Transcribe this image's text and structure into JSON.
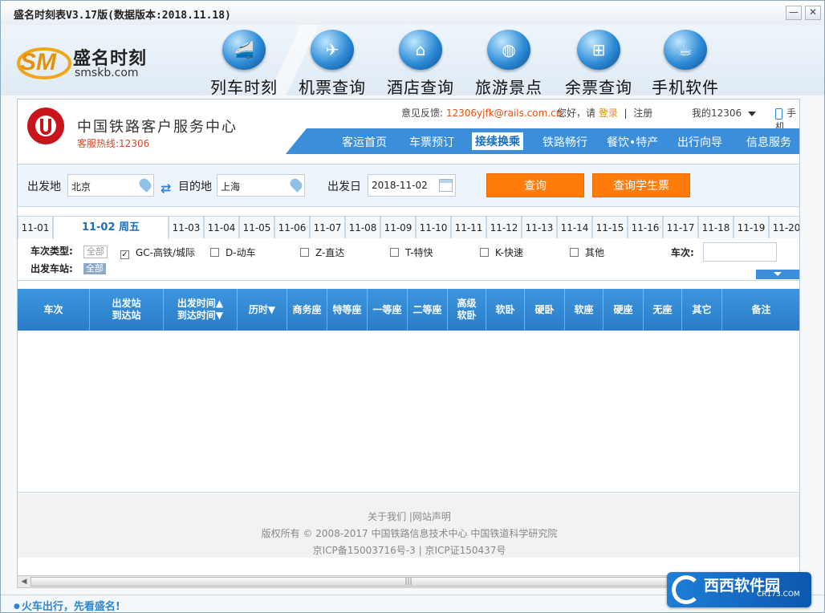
{
  "window": {
    "title": "盛名时刻表V3.17版(数据版本:2018.11.18)",
    "min": "—",
    "close": "✕"
  },
  "brand": {
    "name": "盛名时刻",
    "url": "smskb.com",
    "logo_text": "SM"
  },
  "nav": [
    {
      "label": "列车时刻",
      "icon": "train-icon"
    },
    {
      "label": "机票查询",
      "icon": "plane-icon"
    },
    {
      "label": "酒店查询",
      "icon": "hotel-icon"
    },
    {
      "label": "旅游景点",
      "icon": "globe-icon"
    },
    {
      "label": "余票查询",
      "icon": "windows-icon"
    },
    {
      "label": "手机软件",
      "icon": "java-icon"
    }
  ],
  "site": {
    "center_name": "中国铁路客户服务中心",
    "hotline": "客服热线:12306",
    "feedback_label": "意见反馈:",
    "feedback_email": "12306yjfk@rails.com.cn",
    "greeting": "您好，请",
    "login": "登录",
    "sep": "|",
    "register": "注册",
    "my12306": "我的12306",
    "phone": "手机",
    "menu": [
      "客运首页",
      "车票预订",
      "接续换乘",
      "铁路畅行",
      "餐饮•特产",
      "出行向导",
      "信息服务"
    ],
    "active_menu": "接续换乘"
  },
  "search": {
    "from_label": "出发地",
    "from_value": "北京",
    "to_label": "目的地",
    "to_value": "上海",
    "date_label": "出发日",
    "date_value": "2018-11-02",
    "query_btn": "查询",
    "student_btn": "查询学生票"
  },
  "dates": [
    "11-01",
    "11-02 周五",
    "11-03",
    "11-04",
    "11-05",
    "11-06",
    "11-07",
    "11-08",
    "11-09",
    "11-10",
    "11-11",
    "11-12",
    "11-13",
    "11-14",
    "11-15",
    "11-16",
    "11-17",
    "11-18",
    "11-19",
    "11-20"
  ],
  "filter": {
    "type_label": "车次类型:",
    "station_label": "出发车站:",
    "all": "全部",
    "types": [
      {
        "label": "GC-高铁/城际",
        "checked": true
      },
      {
        "label": "D-动车",
        "checked": false
      },
      {
        "label": "Z-直达",
        "checked": false
      },
      {
        "label": "T-特快",
        "checked": false
      },
      {
        "label": "K-快速",
        "checked": false
      },
      {
        "label": "其他",
        "checked": false
      }
    ],
    "train_no_label": "车次:",
    "checkmark": "✓"
  },
  "table_headers": [
    "车次",
    "出发站\n到达站",
    "出发时间▲\n到达时间▼",
    "历时▼",
    "商务座",
    "特等座",
    "一等座",
    "二等座",
    "高级\n软卧",
    "软卧",
    "硬卧",
    "软座",
    "硬座",
    "无座",
    "其它",
    "备注"
  ],
  "footer": [
    "关于我们   |网站声明",
    "版权所有 © 2008-2017 中国铁路信息技术中心  中国铁道科学研究院",
    "京ICP备15003716号-3  |  京ICP证150437号"
  ],
  "status_text": "火车出行，先看盛名!",
  "watermark": {
    "text": "西西软件园",
    "url": "CR173.COM"
  },
  "colors": {
    "accent": "#3b8ed9",
    "orange": "#ff7b0b",
    "red": "#c8141b"
  }
}
